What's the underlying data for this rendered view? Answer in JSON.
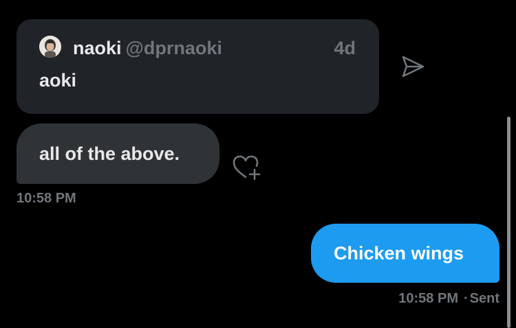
{
  "quote": {
    "display_name": "naoki",
    "handle": "@dprnaoki",
    "age": "4d",
    "text": "aoki"
  },
  "icons": {
    "share": "send-icon",
    "react": "heart-plus-icon",
    "avatar": "user-avatar"
  },
  "messages": {
    "received": {
      "text": "all of the above.",
      "time": "10:58 PM"
    },
    "sent": {
      "text": "Chicken wings",
      "time": "10:58 PM",
      "separator": "·",
      "status": "Sent"
    }
  },
  "colors": {
    "background": "#000000",
    "quote_card": "#202327",
    "received_bubble": "#2f3336",
    "sent_bubble": "#1d9bf0",
    "muted_text": "#71767b",
    "primary_text": "#e7e9ea"
  }
}
